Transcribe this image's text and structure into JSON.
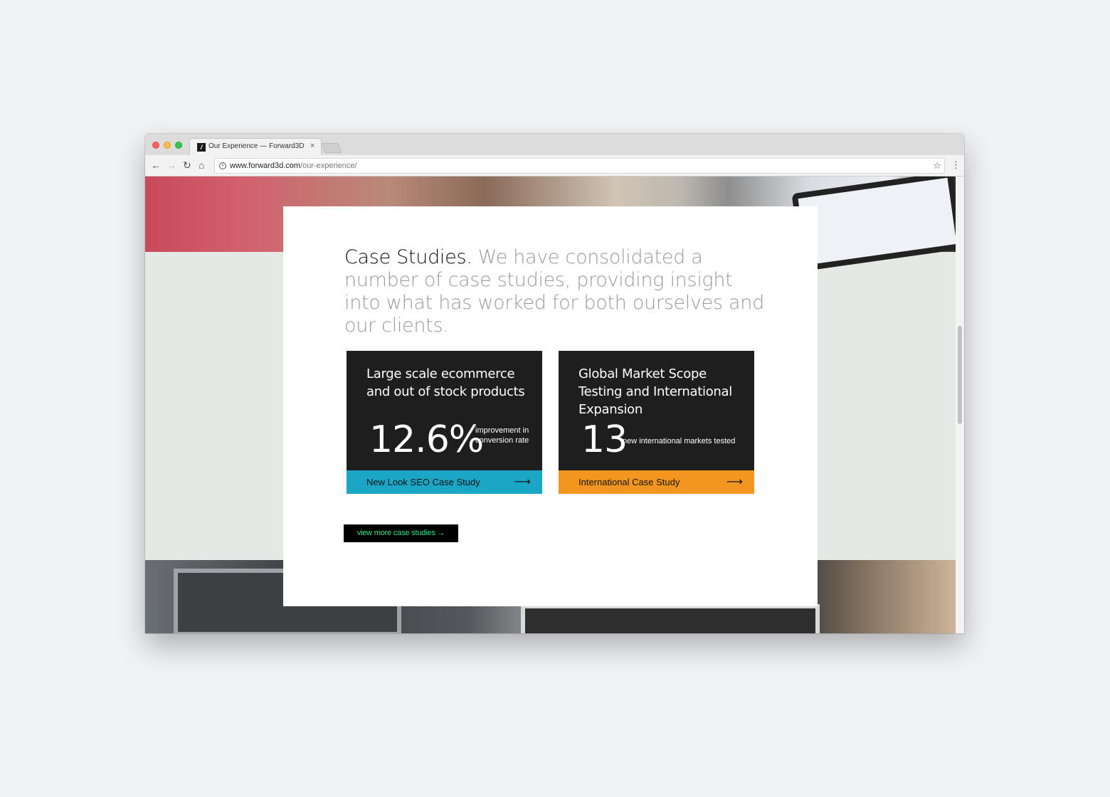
{
  "browser": {
    "tab_title": "Our Experience — Forward3D",
    "tab_favicon": "/",
    "url_host": "www.forward3d.com",
    "url_path": "/our-experience/",
    "icons": {
      "back": "←",
      "forward": "→",
      "reload": "↻",
      "home": "⌂",
      "info": "i",
      "star": "☆",
      "menu": "⋮",
      "close": "×"
    }
  },
  "section": {
    "intro_lead": "Case Studies.",
    "intro_body": " We have consolidated a number of case studies, providing insight into what has worked for both ourselves and our clients."
  },
  "case_studies": [
    {
      "title": "Large scale ecommerce and out of stock products",
      "stat": "12.6%",
      "stat_desc": "improvement in conversion rate",
      "link_label": "New Look SEO Case Study",
      "link_arrow": "⟶",
      "accent": "#1aa6c4"
    },
    {
      "title": "Global Market Scope Testing and International Expansion",
      "stat": "13",
      "stat_desc": "new international markets tested",
      "link_label": "International Case Study",
      "link_arrow": "⟶",
      "accent": "#f2961f"
    }
  ],
  "more_button": "view more case studies →",
  "colors": {
    "card_dark": "#1e1e1e",
    "button_text": "#35e68d",
    "page_bg": "#e4e9e5"
  }
}
